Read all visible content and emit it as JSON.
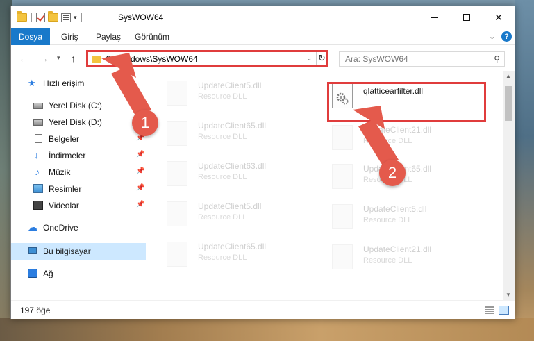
{
  "window": {
    "title": "SysWOW64"
  },
  "ribbon": {
    "tabs": [
      "Dosya",
      "Giriş",
      "Paylaş",
      "Görünüm"
    ]
  },
  "address": {
    "path": "C:\\Windows\\SysWOW64"
  },
  "search": {
    "placeholder": "Ara: SysWOW64"
  },
  "sidebar": {
    "items": [
      {
        "label": "Hızlı erişim",
        "icon": "star-icon"
      },
      {
        "label": "Yerel Disk (C:)",
        "icon": "drive-icon"
      },
      {
        "label": "Yerel Disk (D:)",
        "icon": "drive-icon"
      },
      {
        "label": "Belgeler",
        "icon": "documents-icon"
      },
      {
        "label": "İndirmeler",
        "icon": "downloads-icon"
      },
      {
        "label": "Müzik",
        "icon": "music-icon"
      },
      {
        "label": "Resimler",
        "icon": "pictures-icon"
      },
      {
        "label": "Videolar",
        "icon": "videos-icon"
      },
      {
        "label": "OneDrive",
        "icon": "cloud-icon"
      },
      {
        "label": "Bu bilgisayar",
        "icon": "computer-icon"
      },
      {
        "label": "Ağ",
        "icon": "network-icon"
      }
    ]
  },
  "files": {
    "left_column": [
      {
        "name": "UpdateClient5.dll",
        "type": "Resource DLL"
      },
      {
        "name": "UpdateClient65.dll",
        "type": "Resource DLL"
      },
      {
        "name": "UpdateClient63.dll",
        "type": "Resource DLL"
      },
      {
        "name": "UpdateClient5.dll",
        "type": "Resource DLL"
      },
      {
        "name": "UpdateClient65.dll",
        "type": "Resource DLL"
      }
    ],
    "highlighted": {
      "name": "qlatticearfilter.dll"
    },
    "right_column": [
      {
        "name": "UpdateClient21.dll",
        "type": "Resource DLL"
      },
      {
        "name": "UpdateClient65.dll",
        "type": "Resource DLL"
      },
      {
        "name": "UpdateClient5.dll",
        "type": "Resource DLL"
      },
      {
        "name": "UpdateClient21.dll",
        "type": "Resource DLL"
      }
    ]
  },
  "status": {
    "item_count": "197 öğe"
  },
  "annotations": {
    "step1": "1",
    "step2": "2"
  },
  "colors": {
    "accent": "#1979ca",
    "highlight_red": "#e03c3c",
    "annotation_red": "#e45a4c",
    "selected_bg": "#cde8ff"
  }
}
